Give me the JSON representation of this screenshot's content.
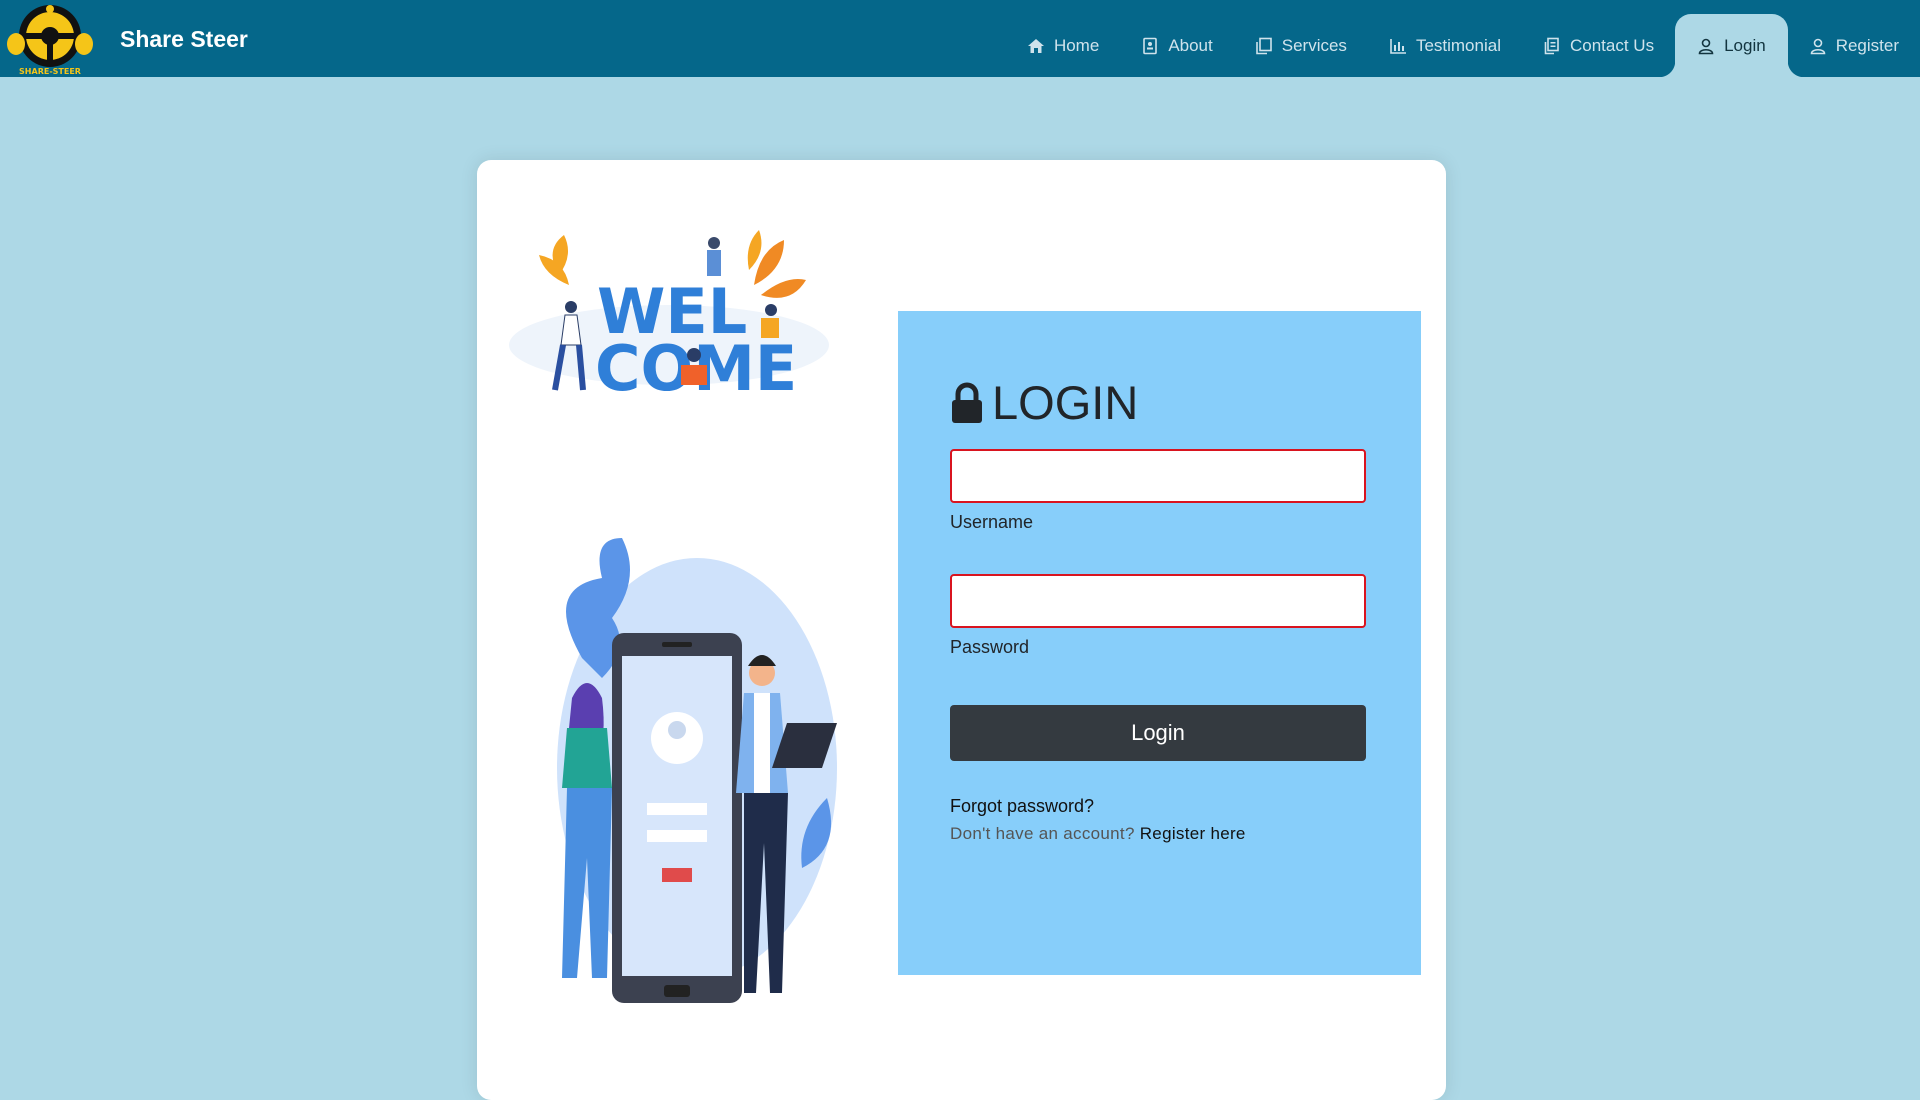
{
  "brand": {
    "name": "Share Steer",
    "logo_text": "SHARE-STEER"
  },
  "nav": {
    "items": [
      {
        "label": "Home",
        "icon": "home-icon"
      },
      {
        "label": "About",
        "icon": "about-icon"
      },
      {
        "label": "Services",
        "icon": "services-icon"
      },
      {
        "label": "Testimonial",
        "icon": "chart-icon"
      },
      {
        "label": "Contact Us",
        "icon": "contact-icon"
      },
      {
        "label": "Login",
        "icon": "user-icon",
        "active": true
      },
      {
        "label": "Register",
        "icon": "user-icon"
      }
    ]
  },
  "welcome": {
    "text_line1": "WEL",
    "text_line2": "COME"
  },
  "login": {
    "title": "LOGIN",
    "username_label": "Username",
    "username_value": "",
    "password_label": "Password",
    "password_value": "",
    "button_label": "Login",
    "forgot_label": "Forgot password?",
    "no_account_text": "Don't have an account?",
    "register_link": "Register here"
  },
  "colors": {
    "navbar": "#05678a",
    "page_background": "#add8e6",
    "login_panel": "#87cefa",
    "login_button": "#343a40",
    "field_border": "#d9141f"
  }
}
